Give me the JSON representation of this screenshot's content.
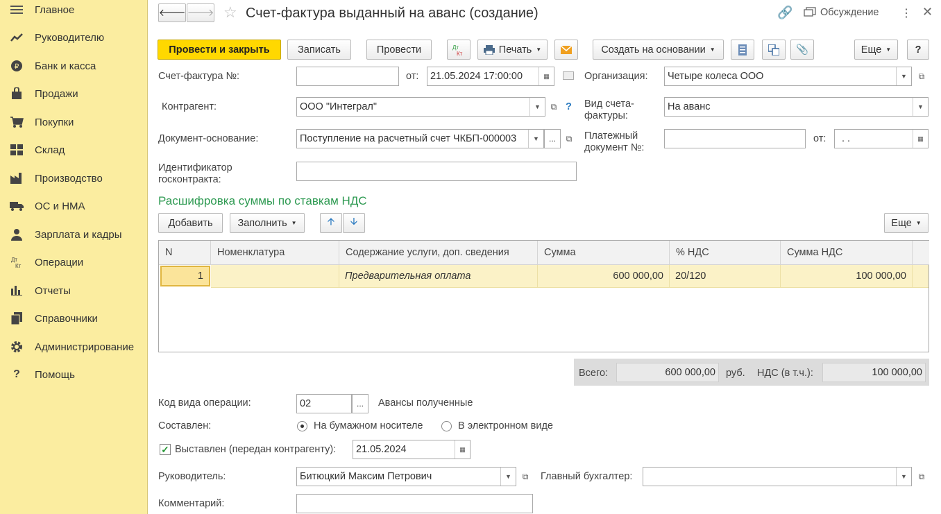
{
  "sidebar": {
    "items": [
      {
        "label": "Главное",
        "icon": "menu-icon"
      },
      {
        "label": "Руководителю",
        "icon": "trend-icon"
      },
      {
        "label": "Банк и касса",
        "icon": "coin-icon"
      },
      {
        "label": "Продажи",
        "icon": "bag-icon"
      },
      {
        "label": "Покупки",
        "icon": "cart-icon"
      },
      {
        "label": "Склад",
        "icon": "warehouse-icon"
      },
      {
        "label": "Производство",
        "icon": "factory-icon"
      },
      {
        "label": "ОС и НМА",
        "icon": "truck-icon"
      },
      {
        "label": "Зарплата и кадры",
        "icon": "person-icon"
      },
      {
        "label": "Операции",
        "icon": "dt-kt-icon"
      },
      {
        "label": "Отчеты",
        "icon": "bar-chart-icon"
      },
      {
        "label": "Справочники",
        "icon": "books-icon"
      },
      {
        "label": "Администрирование",
        "icon": "gear-icon"
      },
      {
        "label": "Помощь",
        "icon": "question-icon"
      }
    ]
  },
  "header": {
    "title": "Счет-фактура выданный на аванс (создание)",
    "discussion": "Обсуждение"
  },
  "toolbar": {
    "post_close": "Провести и закрыть",
    "save": "Записать",
    "post": "Провести",
    "dtkt": "Дт Кт",
    "print": "Печать",
    "create_based": "Создать на основании",
    "more": "Еще",
    "help": "?"
  },
  "form": {
    "invoice_no_label": "Счет-фактура №:",
    "invoice_no": "",
    "from_label": "от:",
    "invoice_date": "21.05.2024 17:00:00",
    "org_label": "Организация:",
    "org": "Четыре колеса ООО",
    "counterparty_label": "Контрагент:",
    "counterparty": "ООО \"Интеграл\"",
    "invoice_kind_label": "Вид счета-фактуры:",
    "invoice_kind": "На аванс",
    "base_doc_label": "Документ-основание:",
    "base_doc": "Поступление на расчетный счет ЧКБП-000003",
    "payment_doc_label": "Платежный документ №:",
    "payment_doc": "",
    "payment_from_label": "от:",
    "payment_date": " .  .",
    "gov_id_label": "Идентификатор госконтракта:",
    "gov_id": ""
  },
  "vat_section": {
    "title": "Расшифровка суммы по ставкам НДС",
    "add": "Добавить",
    "fill": "Заполнить",
    "more": "Еще"
  },
  "table": {
    "columns": [
      "N",
      "Номенклатура",
      "Содержание услуги, доп. сведения",
      "Сумма",
      "% НДС",
      "Сумма НДС"
    ],
    "rows": [
      {
        "n": "1",
        "item": "",
        "content": "Предварительная оплата",
        "sum": "600 000,00",
        "rate": "20/120",
        "vat": "100 000,00"
      }
    ]
  },
  "totals": {
    "total_label": "Всего:",
    "total": "600 000,00",
    "currency": "руб.",
    "vat_label": "НДС (в т.ч.):",
    "vat": "100 000,00"
  },
  "footer": {
    "op_code_label": "Код вида операции:",
    "op_code": "02",
    "op_code_desc": "Авансы полученные",
    "drawn_label": "Составлен:",
    "paper": "На бумажном носителе",
    "electronic": "В электронном виде",
    "issued_label": "Выставлен (передан контрагенту):",
    "issued_date": "21.05.2024",
    "head_label": "Руководитель:",
    "head": "Битюцкий Максим Петрович",
    "chief_acc_label": "Главный бухгалтер:",
    "chief_acc": "",
    "comment_label": "Комментарий:",
    "comment": ""
  }
}
